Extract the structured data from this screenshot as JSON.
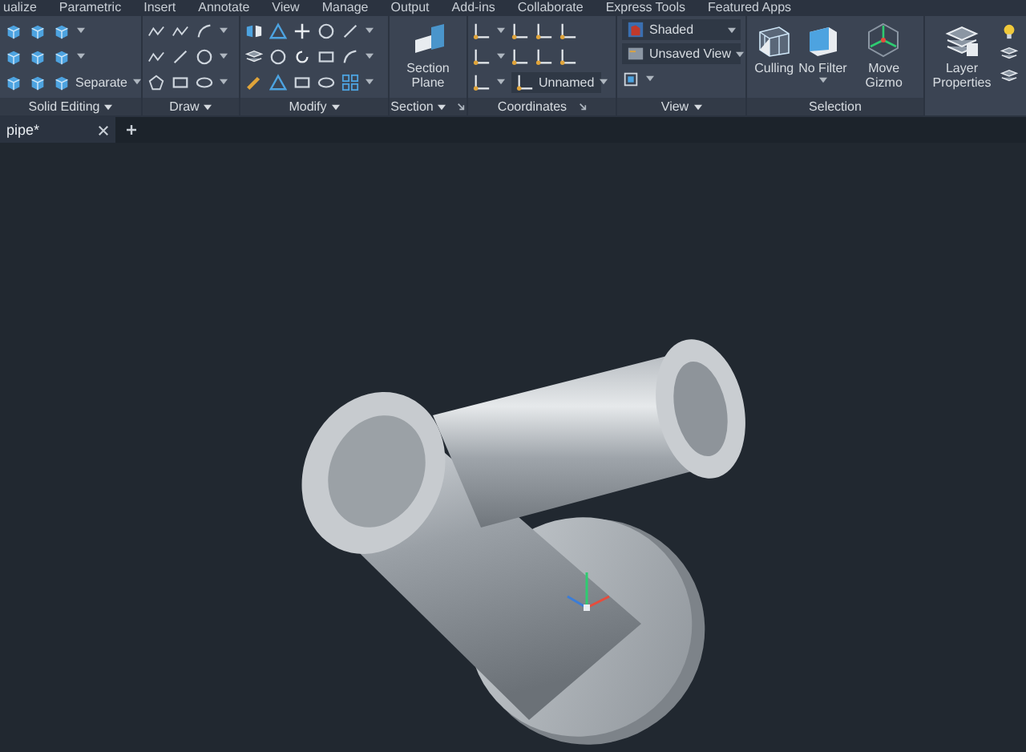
{
  "menu_tabs": [
    "ualize",
    "Parametric",
    "Insert",
    "Annotate",
    "View",
    "Manage",
    "Output",
    "Add-ins",
    "Collaborate",
    "Express Tools",
    "Featured Apps"
  ],
  "ribbon": {
    "panels": [
      {
        "title": "Solid Editing",
        "menu": true,
        "button": "Separate"
      },
      {
        "title": "Draw",
        "menu": true
      },
      {
        "title": "Modify",
        "menu": true
      },
      {
        "title": "Section",
        "menu": true,
        "launcher": true,
        "button": "Section Plane"
      },
      {
        "title": "Coordinates",
        "launcher": true,
        "dropdown": "Unnamed"
      },
      {
        "title": "View",
        "menu": true,
        "visual_style": "Shaded",
        "named_view": "Unsaved View"
      },
      {
        "title": "Selection",
        "buttons": [
          "Culling",
          "No Filter",
          "Move Gizmo"
        ]
      },
      {
        "button": "Layer Properties"
      }
    ]
  },
  "document_tabs": [
    {
      "label": "pipe*",
      "selected": true
    }
  ]
}
